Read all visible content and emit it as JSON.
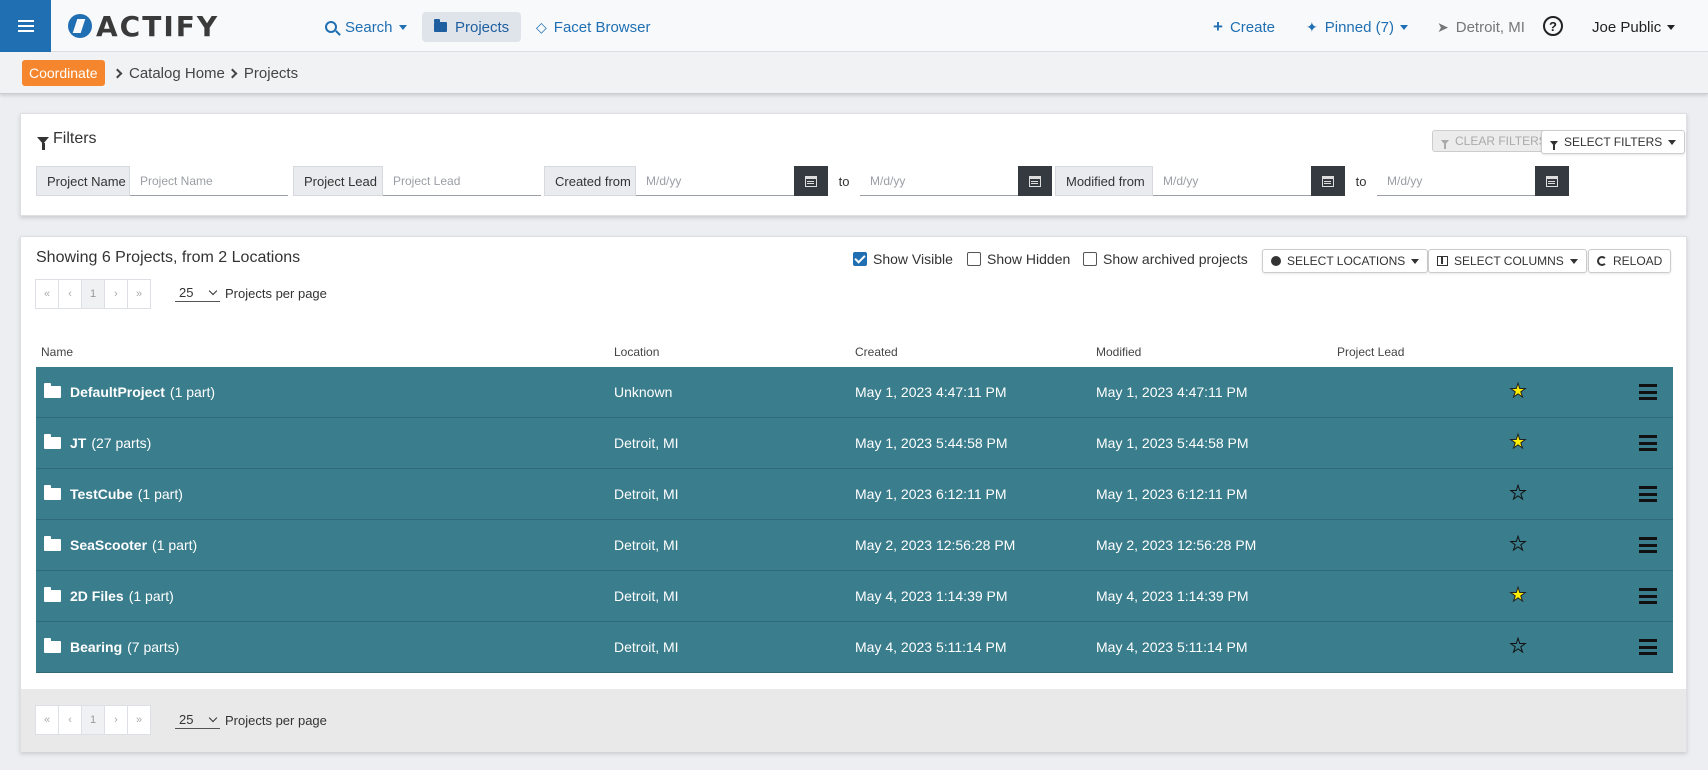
{
  "navbar": {
    "logo_text": "ACTIFY",
    "search_label": "Search",
    "projects_label": "Projects",
    "facet_label": "Facet Browser",
    "create_label": "Create",
    "pinned_label": "Pinned (7)",
    "location_label": "Detroit, MI",
    "help_label": "?",
    "user_label": "Joe Public"
  },
  "breadcrumb": {
    "badge": "Coordinate",
    "items": [
      "Catalog Home",
      "Projects"
    ]
  },
  "filters": {
    "title": "Filters",
    "clear_label": "CLEAR FILTERS",
    "select_label": "SELECT FILTERS",
    "project_name_label": "Project Name",
    "project_name_placeholder": "Project Name",
    "project_lead_label": "Project Lead",
    "project_lead_placeholder": "Project Lead",
    "created_from_label": "Created from",
    "modified_from_label": "Modified from",
    "date_placeholder": "M/d/yy",
    "to_label": "to"
  },
  "projects": {
    "showing_text": "Showing 6 Projects, from 2 Locations",
    "show_visible": "Show Visible",
    "show_visible_checked": true,
    "show_hidden": "Show Hidden",
    "show_hidden_checked": false,
    "show_archived": "Show archived projects",
    "show_archived_checked": false,
    "select_locations": "SELECT LOCATIONS",
    "select_columns": "SELECT COLUMNS",
    "reload": "RELOAD",
    "pager": {
      "first": "«",
      "prev": "‹",
      "page": "1",
      "next": "›",
      "last": "»"
    },
    "per_page_value": "25",
    "per_page_label": "Projects per page",
    "columns": {
      "name": "Name",
      "location": "Location",
      "created": "Created",
      "modified": "Modified",
      "lead": "Project Lead"
    },
    "row_color": "#3a7d8c",
    "rows": [
      {
        "name": "DefaultProject",
        "parts": "(1 part)",
        "location": "Unknown",
        "created": "May 1, 2023 4:47:11 PM",
        "modified": "May 1, 2023 4:47:11 PM",
        "lead": "",
        "starred": true
      },
      {
        "name": "JT",
        "parts": "(27 parts)",
        "location": "Detroit, MI",
        "created": "May 1, 2023 5:44:58 PM",
        "modified": "May 1, 2023 5:44:58 PM",
        "lead": "",
        "starred": true
      },
      {
        "name": "TestCube",
        "parts": "(1 part)",
        "location": "Detroit, MI",
        "created": "May 1, 2023 6:12:11 PM",
        "modified": "May 1, 2023 6:12:11 PM",
        "lead": "",
        "starred": false
      },
      {
        "name": "SeaScooter",
        "parts": "(1 part)",
        "location": "Detroit, MI",
        "created": "May 2, 2023 12:56:28 PM",
        "modified": "May 2, 2023 12:56:28 PM",
        "lead": "",
        "starred": false
      },
      {
        "name": "2D Files",
        "parts": "(1 part)",
        "location": "Detroit, MI",
        "created": "May 4, 2023 1:14:39 PM",
        "modified": "May 4, 2023 1:14:39 PM",
        "lead": "",
        "starred": true
      },
      {
        "name": "Bearing",
        "parts": "(7 parts)",
        "location": "Detroit, MI",
        "created": "May 4, 2023 5:11:14 PM",
        "modified": "May 4, 2023 5:11:14 PM",
        "lead": "",
        "starred": false
      }
    ]
  }
}
